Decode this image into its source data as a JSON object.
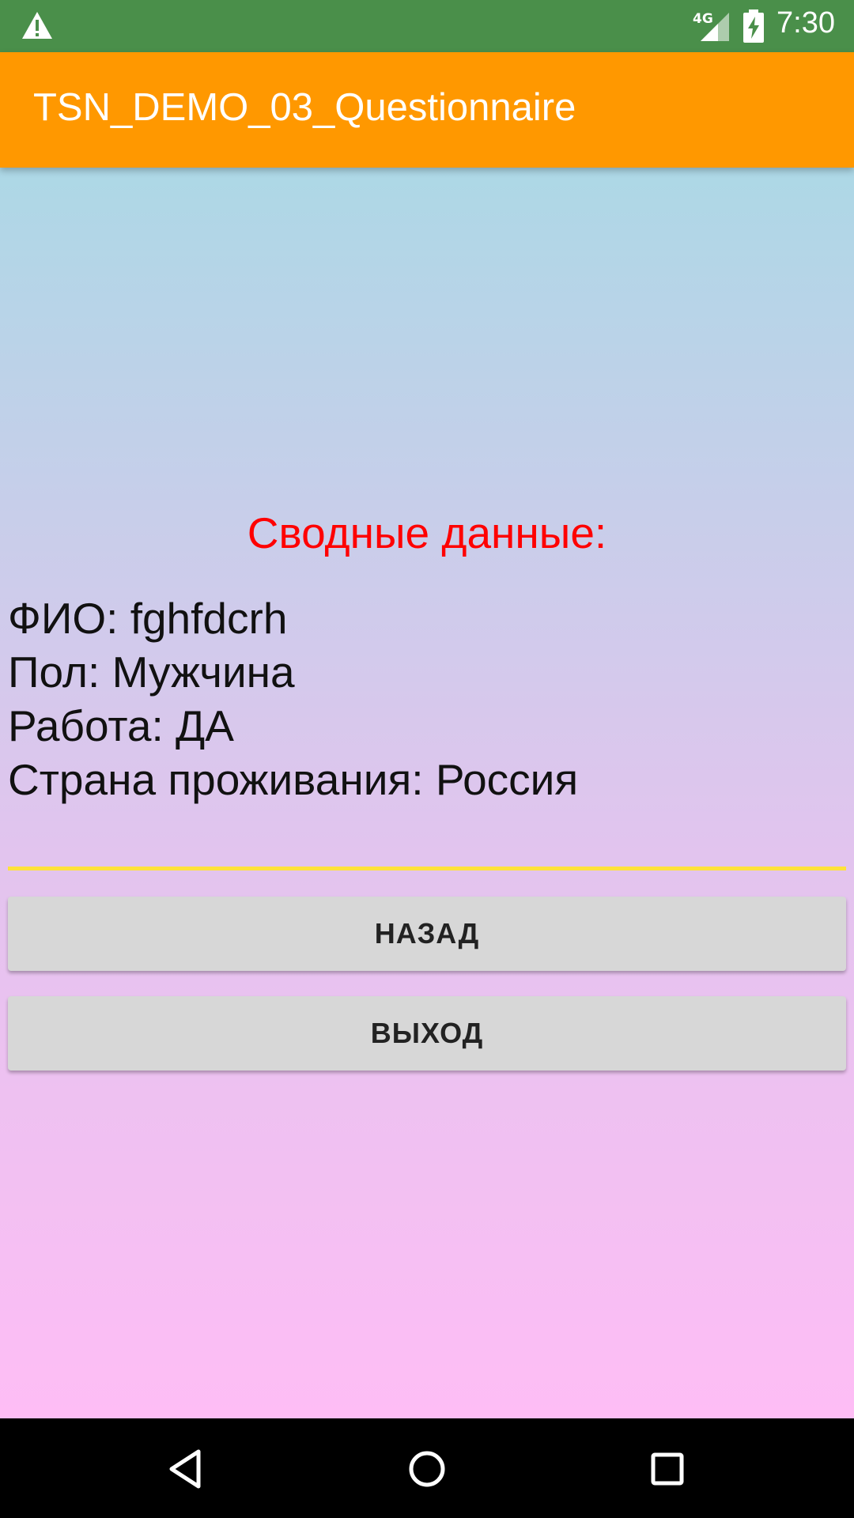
{
  "status_bar": {
    "time": "7:30",
    "network_type": "4G",
    "icons": [
      "warning-icon",
      "signal-icon",
      "battery-charging-icon"
    ]
  },
  "app_bar": {
    "title": "TSN_DEMO_03_Questionnaire",
    "color": "#FF9800"
  },
  "summary": {
    "title": "Сводные данные:",
    "title_color": "#FF0000",
    "lines": [
      "ФИО: fghfdcrh",
      "Пол: Мужчина",
      "Работа: ДА",
      "Страна проживания: Россия"
    ]
  },
  "divider_color": "#FFE23A",
  "buttons": {
    "back_label": "НАЗАД",
    "exit_label": "ВЫХОД"
  },
  "nav_bar": {
    "icons": [
      "back-icon",
      "home-icon",
      "recent-apps-icon"
    ]
  }
}
